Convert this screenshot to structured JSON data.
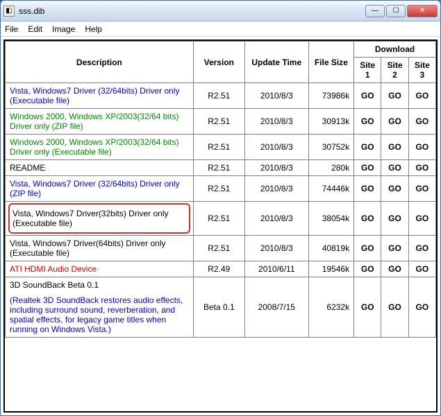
{
  "window": {
    "title": "sss.dib"
  },
  "menu": {
    "file": "File",
    "edit": "Edit",
    "image": "Image",
    "help": "Help"
  },
  "headers": {
    "description": "Description",
    "version": "Version",
    "update_time": "Update Time",
    "file_size": "File Size",
    "download": "Download",
    "site1": "Site 1",
    "site2": "Site 2",
    "site3": "Site 3"
  },
  "go_label": "GO",
  "rows": [
    {
      "desc": "Vista, Windows7 Driver (32/64bits) Driver only (Executable file)",
      "cls": "link-blue",
      "ver": "R2.51",
      "upd": "2010/8/3",
      "size": "73986k",
      "hl": false
    },
    {
      "desc": "Windows 2000, Windows XP/2003(32/64 bits) Driver only (ZIP file)",
      "cls": "link-green",
      "ver": "R2.51",
      "upd": "2010/8/3",
      "size": "30913k",
      "hl": false
    },
    {
      "desc": "Windows 2000, Windows XP/2003(32/64 bits) Driver only (Executable file)",
      "cls": "link-green",
      "ver": "R2.51",
      "upd": "2010/8/3",
      "size": "30752k",
      "hl": false
    },
    {
      "desc": "README",
      "cls": "link-black",
      "ver": "R2.51",
      "upd": "2010/8/3",
      "size": "280k",
      "hl": false
    },
    {
      "desc": "Vista, Windows7 Driver (32/64bits) Driver only (ZIP file)",
      "cls": "link-blue",
      "ver": "R2.51",
      "upd": "2010/8/3",
      "size": "74446k",
      "hl": false
    },
    {
      "desc": "Vista, Windows7 Driver(32bits) Driver only (Executable file)",
      "cls": "link-black",
      "ver": "R2.51",
      "upd": "2010/8/3",
      "size": "38054k",
      "hl": true
    },
    {
      "desc": "Vista, Windows7 Driver(64bits) Driver only (Executable file)",
      "cls": "link-black",
      "ver": "R2.51",
      "upd": "2010/8/3",
      "size": "40819k",
      "hl": false
    },
    {
      "desc": "ATI HDMI Audio Device",
      "cls": "link-red",
      "ver": "R2.49",
      "upd": "2010/6/11",
      "size": "19546k",
      "hl": false
    },
    {
      "desc": "3D SoundBack Beta 0.1",
      "sub": "(Realtek 3D SoundBack restores audio effects, including surround sound, reverberation, and spatial effects, for legacy game titles when running on Windows Vista.)",
      "cls": "link-black",
      "ver": "Beta 0.1",
      "upd": "2008/7/15",
      "size": "6232k",
      "hl": false
    }
  ]
}
